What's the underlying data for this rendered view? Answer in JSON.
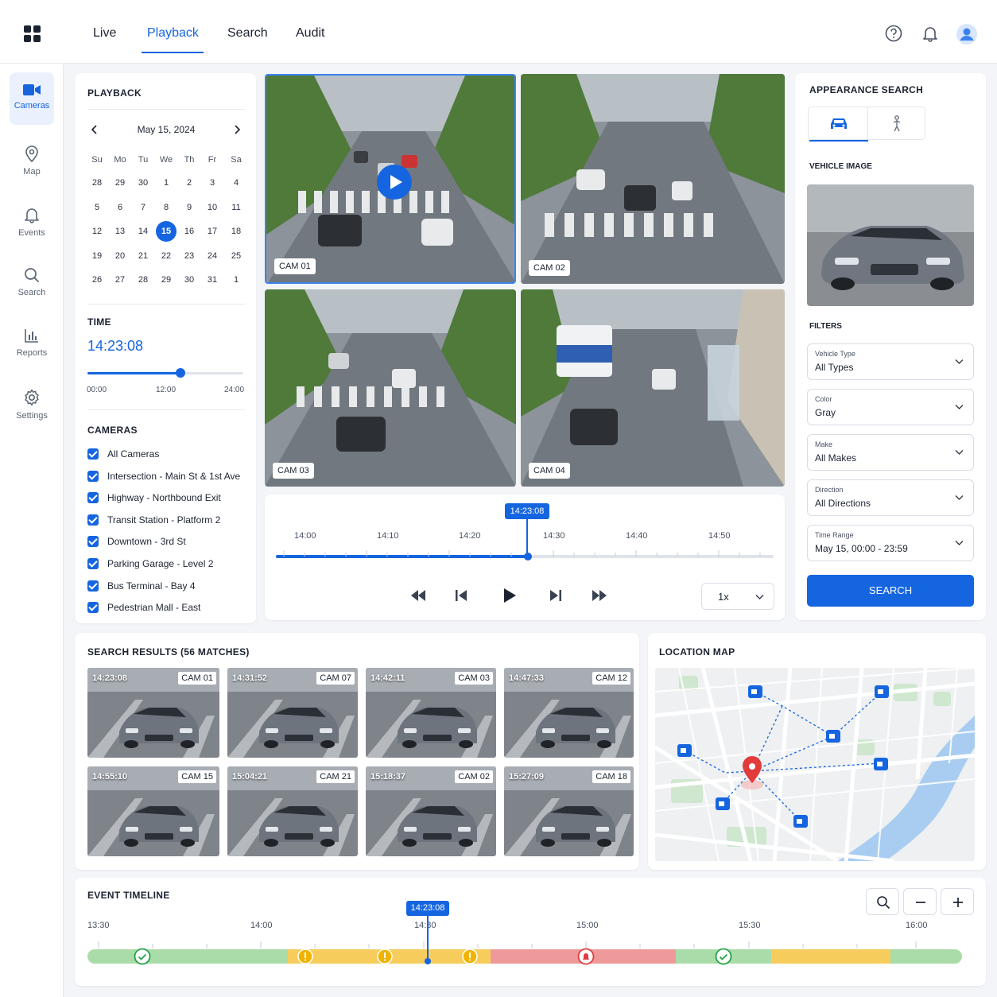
{
  "nav": {
    "tabs": [
      "Live",
      "Playback",
      "Search",
      "Audit"
    ],
    "active": "Playback"
  },
  "sidebar": {
    "items": [
      {
        "label": "Cameras",
        "icon": "video-camera-icon"
      },
      {
        "label": "Map",
        "icon": "map-pin-icon"
      },
      {
        "label": "Events",
        "icon": "bell-icon"
      },
      {
        "label": "Search",
        "icon": "search-icon"
      },
      {
        "label": "Reports",
        "icon": "bar-chart-icon"
      },
      {
        "label": "Settings",
        "icon": "gear-icon"
      }
    ]
  },
  "playback": {
    "title": "PLAYBACK",
    "month": "May 15, 2024",
    "weekdays": [
      "Su",
      "Mo",
      "Tu",
      "We",
      "Th",
      "Fr",
      "Sa"
    ],
    "weeks": [
      [
        "28",
        "29",
        "30",
        "1",
        "2",
        "3",
        "4"
      ],
      [
        "5",
        "6",
        "7",
        "8",
        "9",
        "10",
        "11"
      ],
      [
        "12",
        "13",
        "14",
        "15",
        "16",
        "17",
        "18"
      ],
      [
        "19",
        "20",
        "21",
        "22",
        "23",
        "24",
        "25"
      ],
      [
        "26",
        "27",
        "28",
        "29",
        "30",
        "31",
        "1"
      ]
    ],
    "selected_day": "15",
    "time_title": "TIME",
    "time_value": "14:23:08",
    "time_fraction": 0.5994,
    "time_ticks": [
      "00:00",
      "12:00",
      "24:00"
    ]
  },
  "cameras": {
    "title": "CAMERAS",
    "items": [
      "All Cameras",
      "Intersection - Main St & 1st Ave",
      "Highway - Northbound Exit",
      "Transit Station - Platform 2",
      "Downtown - 3rd St",
      "Parking Garage - Level 2",
      "Bus Terminal - Bay 4",
      "Pedestrian Mall - East"
    ]
  },
  "video": {
    "tiles": [
      "CAM 01",
      "CAM 02",
      "CAM 03",
      "CAM 04"
    ]
  },
  "player": {
    "current": "14:23:08",
    "ticks": [
      "14:00",
      "14:10",
      "14:20",
      "14:30",
      "14:40",
      "14:50"
    ],
    "speed": "1x"
  },
  "appearance": {
    "title": "APPEARANCE SEARCH",
    "image_label": "VEHICLE IMAGE",
    "filters_title": "FILTERS",
    "filters": [
      {
        "label": "Vehicle Type",
        "value": "All Types"
      },
      {
        "label": "Color",
        "value": "Gray"
      },
      {
        "label": "Make",
        "value": "All Makes"
      },
      {
        "label": "Direction",
        "value": "All Directions"
      },
      {
        "label": "Time Range",
        "value": "May 15, 00:00 - 23:59"
      }
    ],
    "search_button": "SEARCH"
  },
  "results": {
    "title": "SEARCH RESULTS (56 MATCHES)",
    "items": [
      {
        "time": "14:23:08",
        "cam": "CAM 01"
      },
      {
        "time": "14:31:52",
        "cam": "CAM 07"
      },
      {
        "time": "14:42:11",
        "cam": "CAM 03"
      },
      {
        "time": "14:47:33",
        "cam": "CAM 12"
      },
      {
        "time": "14:55:10",
        "cam": "CAM 15"
      },
      {
        "time": "15:04:21",
        "cam": "CAM 21"
      },
      {
        "time": "15:18:37",
        "cam": "CAM 02"
      },
      {
        "time": "15:27:09",
        "cam": "CAM 18"
      }
    ]
  },
  "map": {
    "title": "LOCATION MAP"
  },
  "timeline": {
    "title": "EVENT TIMELINE",
    "current": "14:23:08",
    "ticks": [
      "13:30",
      "14:00",
      "14:30",
      "15:00",
      "15:30",
      "16:00"
    ]
  },
  "colors": {
    "accent": "#1565e0",
    "ok": "#22a447",
    "warn": "#f0b400",
    "alert": "#e23b3b"
  }
}
